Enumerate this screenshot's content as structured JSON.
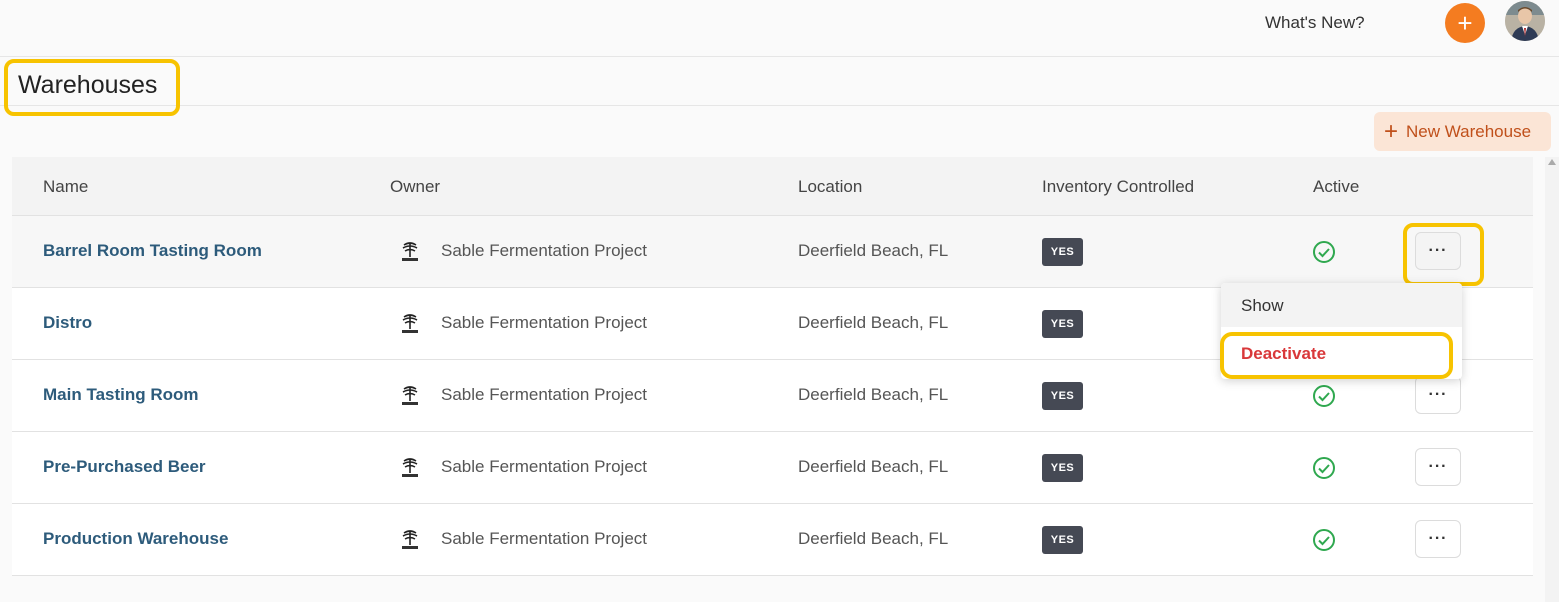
{
  "topbar": {
    "whats_new": "What's New?",
    "plus_icon": "plus-icon"
  },
  "page": {
    "title": "Warehouses",
    "new_button": "New Warehouse"
  },
  "table": {
    "columns": [
      "Name",
      "Owner",
      "Location",
      "Inventory Controlled",
      "Active"
    ],
    "rows": [
      {
        "name": "Barrel Room Tasting Room",
        "owner": "Sable Fermentation Project",
        "location": "Deerfield Beach, FL",
        "inventory": "YES"
      },
      {
        "name": "Distro",
        "owner": "Sable Fermentation Project",
        "location": "Deerfield Beach, FL",
        "inventory": "YES"
      },
      {
        "name": "Main Tasting Room",
        "owner": "Sable Fermentation Project",
        "location": "Deerfield Beach, FL",
        "inventory": "YES"
      },
      {
        "name": "Pre-Purchased Beer",
        "owner": "Sable Fermentation Project",
        "location": "Deerfield Beach, FL",
        "inventory": "YES"
      },
      {
        "name": "Production Warehouse",
        "owner": "Sable Fermentation Project",
        "location": "Deerfield Beach, FL",
        "inventory": "YES"
      }
    ],
    "actions_label": "···"
  },
  "dropdown": {
    "show": "Show",
    "deactivate": "Deactivate"
  },
  "colors": {
    "accent": "#f47c20",
    "link": "#2d5b7b",
    "danger": "#d9383a",
    "active_check": "#2fa84f",
    "highlight": "#f7c300"
  }
}
